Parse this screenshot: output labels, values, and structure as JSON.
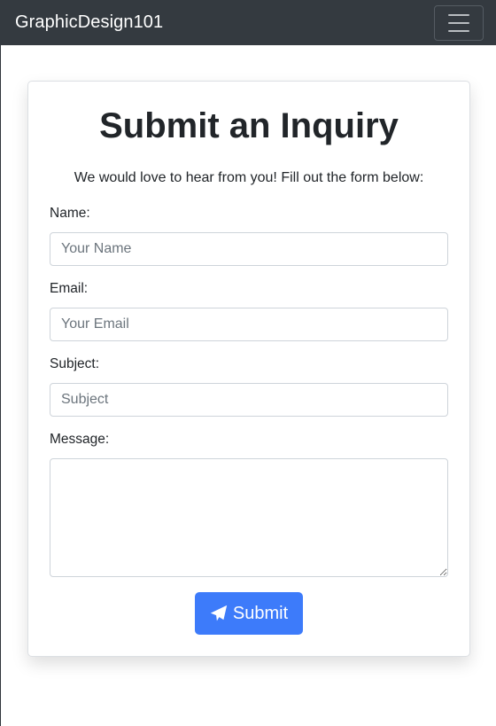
{
  "navbar": {
    "brand": "GraphicDesign101",
    "menu_icon": "hamburger-menu-icon"
  },
  "form": {
    "title": "Submit an Inquiry",
    "subtitle": "We would love to hear from you! Fill out the form below:",
    "fields": [
      {
        "label": "Name:",
        "placeholder": "Your Name",
        "value": ""
      },
      {
        "label": "Email:",
        "placeholder": "Your Email",
        "value": ""
      },
      {
        "label": "Subject:",
        "placeholder": "Subject",
        "value": ""
      },
      {
        "label": "Message:",
        "placeholder": "",
        "value": ""
      }
    ],
    "submit": {
      "label": "Submit",
      "icon": "paper-plane-icon"
    }
  },
  "colors": {
    "navbar_bg": "#343a40",
    "primary": "#3d7bfa",
    "text": "#212529"
  }
}
